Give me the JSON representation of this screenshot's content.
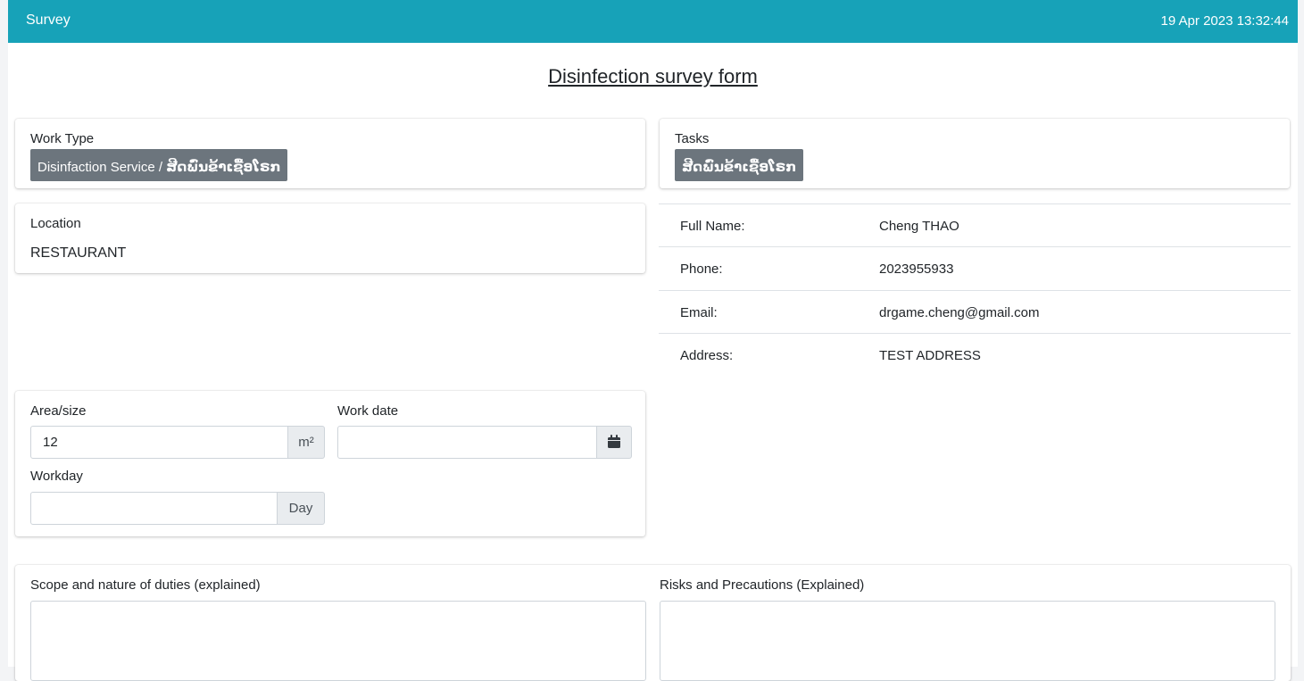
{
  "header": {
    "title": "Survey",
    "datetime": "19 Apr 2023 13:32:44"
  },
  "form_title": "Disinfection survey form",
  "work_type": {
    "label": "Work Type",
    "badge_en": "Disinfaction Service / ",
    "badge_lao": "ສີດພົ່ນຂ້າເຊື້ອໂຣກ"
  },
  "tasks": {
    "label": "Tasks",
    "badge": "ສີດພົ່ນຂ້າເຊື້ອໂຣກ"
  },
  "location": {
    "label": "Location",
    "value": "RESTAURANT"
  },
  "customer": {
    "rows": [
      {
        "key": "Full Name:",
        "value": "Cheng THAO"
      },
      {
        "key": "Phone:",
        "value": "2023955933"
      },
      {
        "key": "Email:",
        "value": "drgame.cheng@gmail.com"
      },
      {
        "key": "Address:",
        "value": "TEST ADDRESS"
      }
    ]
  },
  "area": {
    "label": "Area/size",
    "value": "12",
    "unit": "m²"
  },
  "work_date": {
    "label": "Work date",
    "value": "",
    "icon": "calendar-icon"
  },
  "workday": {
    "label": "Workday",
    "value": "",
    "unit": "Day"
  },
  "scope": {
    "label": "Scope and nature of duties (explained)",
    "value": ""
  },
  "risks": {
    "label": "Risks and Precautions (Explained)",
    "value": ""
  }
}
